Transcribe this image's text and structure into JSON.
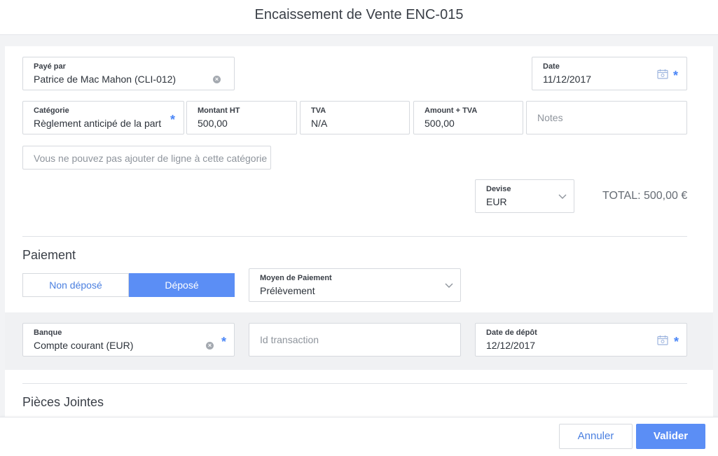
{
  "header": {
    "title": "Encaissement de Vente ENC-015"
  },
  "form": {
    "paye_par": {
      "label": "Payé par",
      "value": "Patrice de Mac Mahon (CLI-012)"
    },
    "date": {
      "label": "Date",
      "value": "11/12/2017"
    },
    "categorie": {
      "label": "Catégorie",
      "value": "Règlement anticipé de la part"
    },
    "montant_ht": {
      "label": "Montant HT",
      "value": "500,00"
    },
    "tva": {
      "label": "TVA",
      "value": "N/A"
    },
    "amount_tva": {
      "label": "Amount + TVA",
      "value": "500,00"
    },
    "notes": {
      "placeholder": "Notes"
    },
    "notice": "Vous ne pouvez pas ajouter de ligne à cette catégorie",
    "devise": {
      "label": "Devise",
      "value": "EUR"
    },
    "total": "TOTAL: 500,00 €",
    "required_mark": "*"
  },
  "paiement": {
    "title": "Paiement",
    "toggle": {
      "off_label": "Non déposé",
      "on_label": "Déposé",
      "selected": "Déposé"
    },
    "moyen": {
      "label": "Moyen de Paiement",
      "value": "Prélèvement"
    },
    "banque": {
      "label": "Banque",
      "value": "Compte courant (EUR)"
    },
    "id_transaction": {
      "placeholder": "Id transaction"
    },
    "date_depot": {
      "label": "Date de dépôt",
      "value": "12/12/2017"
    }
  },
  "pieces": {
    "title": "Pièces Jointes"
  },
  "footer": {
    "cancel_label": "Annuler",
    "ok_label": "Valider"
  },
  "colors": {
    "accent": "#5b8ef5",
    "link": "#4a7fe0",
    "required": "#4a86f7"
  },
  "icons": {
    "calendar": "calendar-icon",
    "clear": "clear-icon",
    "chevron": "chevron-down-icon"
  }
}
